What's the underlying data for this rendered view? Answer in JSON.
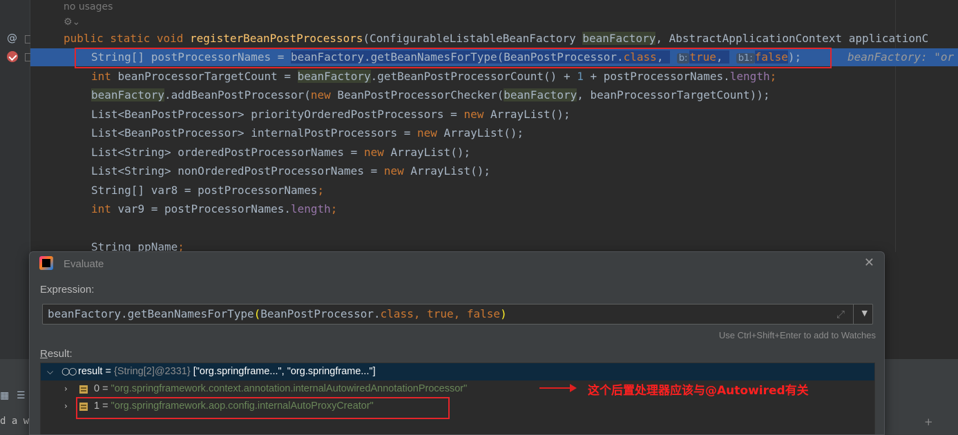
{
  "gutter": {
    "at_label": "@"
  },
  "editor": {
    "usages": "no usages",
    "method_sig": {
      "mods": "public static void ",
      "name": "registerBeanPostProcessors",
      "open": "(ConfigurableListableBeanFactory ",
      "p1": "beanFactory",
      "rest": ", AbstractApplicationContext applicationC"
    },
    "line1": {
      "a": "String[] postProcessorNames = ",
      "b": "beanFactory",
      "c": ".getBeanNamesForType(BeanPostProcessor.",
      "d": "class",
      "e": ", ",
      "hint_b": "b:",
      "v_true": "true",
      "f": ", ",
      "hint_b1": "b1:",
      "v_false": "false",
      "g": ");",
      "inline_hint": "beanFactory: \"or"
    },
    "line2": {
      "kw": "int",
      "a": " beanProcessorTargetCount = ",
      "b": "beanFactory",
      "c": ".getBeanPostProcessorCount() + ",
      "num": "1",
      "d": " + postProcessorNames.",
      "field": "length",
      "e": ";"
    },
    "line3": {
      "a": "beanFactory",
      "b": ".addBeanPostProcessor(",
      "kw": "new",
      "c": " BeanPostProcessorChecker(",
      "d": "beanFactory",
      "e": ", beanProcessorTargetCount));"
    },
    "line4": {
      "a": "List<BeanPostProcessor> priorityOrderedPostProcessors = ",
      "kw": "new",
      "b": " ArrayList();"
    },
    "line5": {
      "a": "List<BeanPostProcessor> internalPostProcessors = ",
      "kw": "new",
      "b": " ArrayList();"
    },
    "line6": {
      "a": "List<String> orderedPostProcessorNames = ",
      "kw": "new",
      "b": " ArrayList();"
    },
    "line7": {
      "a": "List<String> nonOrderedPostProcessorNames = ",
      "kw": "new",
      "b": " ArrayList();"
    },
    "line8": {
      "a": "String[] var8 = postProcessorNames",
      "semi": ";"
    },
    "line9": {
      "kw": "int",
      "a": " var9 = postProcessorNames.",
      "field": "length",
      "semi": ";"
    },
    "line10": {
      "a": "String ppName",
      "semi": ";"
    }
  },
  "dialog": {
    "title": "Evaluate",
    "close": "✕",
    "expression_label": "Expression:",
    "expression": {
      "a": "beanFactory.getBeanNamesForType",
      "p_open": "(",
      "b": "BeanPostProcessor.",
      "kw_class": "class",
      "c": ", ",
      "kw_true": "true",
      "d": ", ",
      "kw_false": "false",
      "p_close": ")"
    },
    "watch_hint": "Use Ctrl+Shift+Enter to add to Watches",
    "result_label_u": "R",
    "result_label_rest": "esult:",
    "result": {
      "name": "result",
      "eq": " = ",
      "type": "{String[2]@2331}",
      "value": " [\"org.springframe...\", \"org.springframe...\"]",
      "items": [
        {
          "index": "0",
          "eq": " = ",
          "value": "\"org.springframework.context.annotation.internalAutowiredAnnotationProcessor\""
        },
        {
          "index": "1",
          "eq": " = ",
          "value": "\"org.springframework.aop.config.internalAutoProxyCreator\""
        }
      ]
    },
    "annotation": "这个后置处理器应该与@Autowired有关"
  },
  "bottom": {
    "tb1": "▦",
    "tb2": "☰",
    "tb3": "d a w",
    "plus": "+"
  },
  "colors": {
    "editor_bg": "#2b2b2b",
    "highlight_line": "#2d5b9e",
    "keyword": "#cc7832",
    "method": "#ffc66d",
    "string": "#6a8759",
    "annotation_red": "#e5252a"
  }
}
